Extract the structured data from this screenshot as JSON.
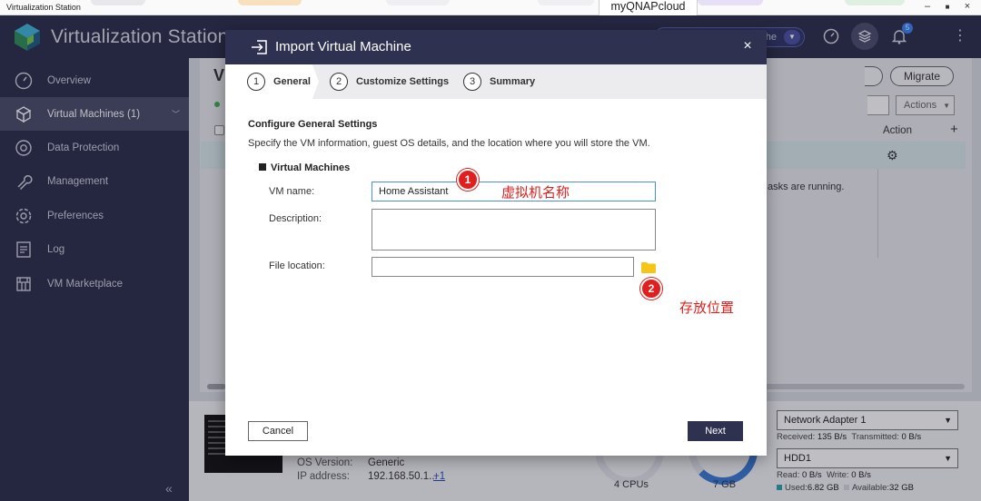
{
  "window": {
    "title": "Virtualization Station",
    "tab_label": "myQNAPcloud",
    "controls": {
      "minimize": "–",
      "maximize": "■",
      "close": "×"
    }
  },
  "header": {
    "app_name": "Virtualization Station",
    "pill_text": "he",
    "notification_count": "5",
    "icons": [
      "speedometer-icon",
      "stack-icon",
      "bell-icon",
      "more-icon"
    ]
  },
  "sidebar": {
    "items": [
      {
        "label": "Overview",
        "icon": "overview-icon"
      },
      {
        "label": "Virtual Machines (1)",
        "icon": "vm-icon",
        "active": true
      },
      {
        "label": "Data Protection",
        "icon": "data-protection-icon"
      },
      {
        "label": "Management",
        "icon": "wrench-icon"
      },
      {
        "label": "Preferences",
        "icon": "gear-icon"
      },
      {
        "label": "Log",
        "icon": "log-icon"
      },
      {
        "label": "VM Marketplace",
        "icon": "marketplace-icon"
      }
    ],
    "collapse": "«"
  },
  "background": {
    "title_fragment": "V",
    "migrate_label": "Migrate",
    "actions_label": "Actions",
    "column_action": "Action",
    "add": "+",
    "running_text": "asks are running.",
    "os_version_label": "OS Version:",
    "os_version_value": "Generic",
    "ip_label": "IP address:",
    "ip_value": "192.168.50.1...",
    "ip_more": "+1",
    "cpus": "4 CPUs",
    "memory": "7 GB",
    "network": {
      "selected": "Network Adapter 1",
      "received_label": "Received:",
      "received_value": "135 B/s",
      "transmitted_label": "Transmitted:",
      "transmitted_value": "0 B/s"
    },
    "disk": {
      "selected": "HDD1",
      "read_label": "Read:",
      "read_value": "0 B/s",
      "write_label": "Write:",
      "write_value": "0 B/s",
      "used_label": "Used:",
      "used_value": "6.82 GB",
      "available_label": "Available:",
      "available_value": "32 GB"
    }
  },
  "modal": {
    "title": "Import Virtual Machine",
    "close": "×",
    "steps": [
      {
        "num": "1",
        "label": "General",
        "active": true
      },
      {
        "num": "2",
        "label": "Customize Settings"
      },
      {
        "num": "3",
        "label": "Summary"
      }
    ],
    "section_title": "Configure General Settings",
    "section_desc": "Specify the VM information, guest OS details, and the location where you will store the VM.",
    "group_title": "Virtual Machines",
    "fields": {
      "vm_name_label": "VM name:",
      "vm_name_value": "Home Assistant",
      "description_label": "Description:",
      "description_value": "",
      "file_location_label": "File location:",
      "file_location_value": ""
    },
    "cancel_label": "Cancel",
    "next_label": "Next"
  },
  "annotations": [
    {
      "num": "1",
      "text": "虚拟机名称"
    },
    {
      "num": "2",
      "text": "存放位置"
    }
  ],
  "colors": {
    "header_bg": "#2b2d4a",
    "modal_head_bg": "#2f3150",
    "annotation_red": "#e0201e",
    "folder_yellow": "#f5c518"
  }
}
